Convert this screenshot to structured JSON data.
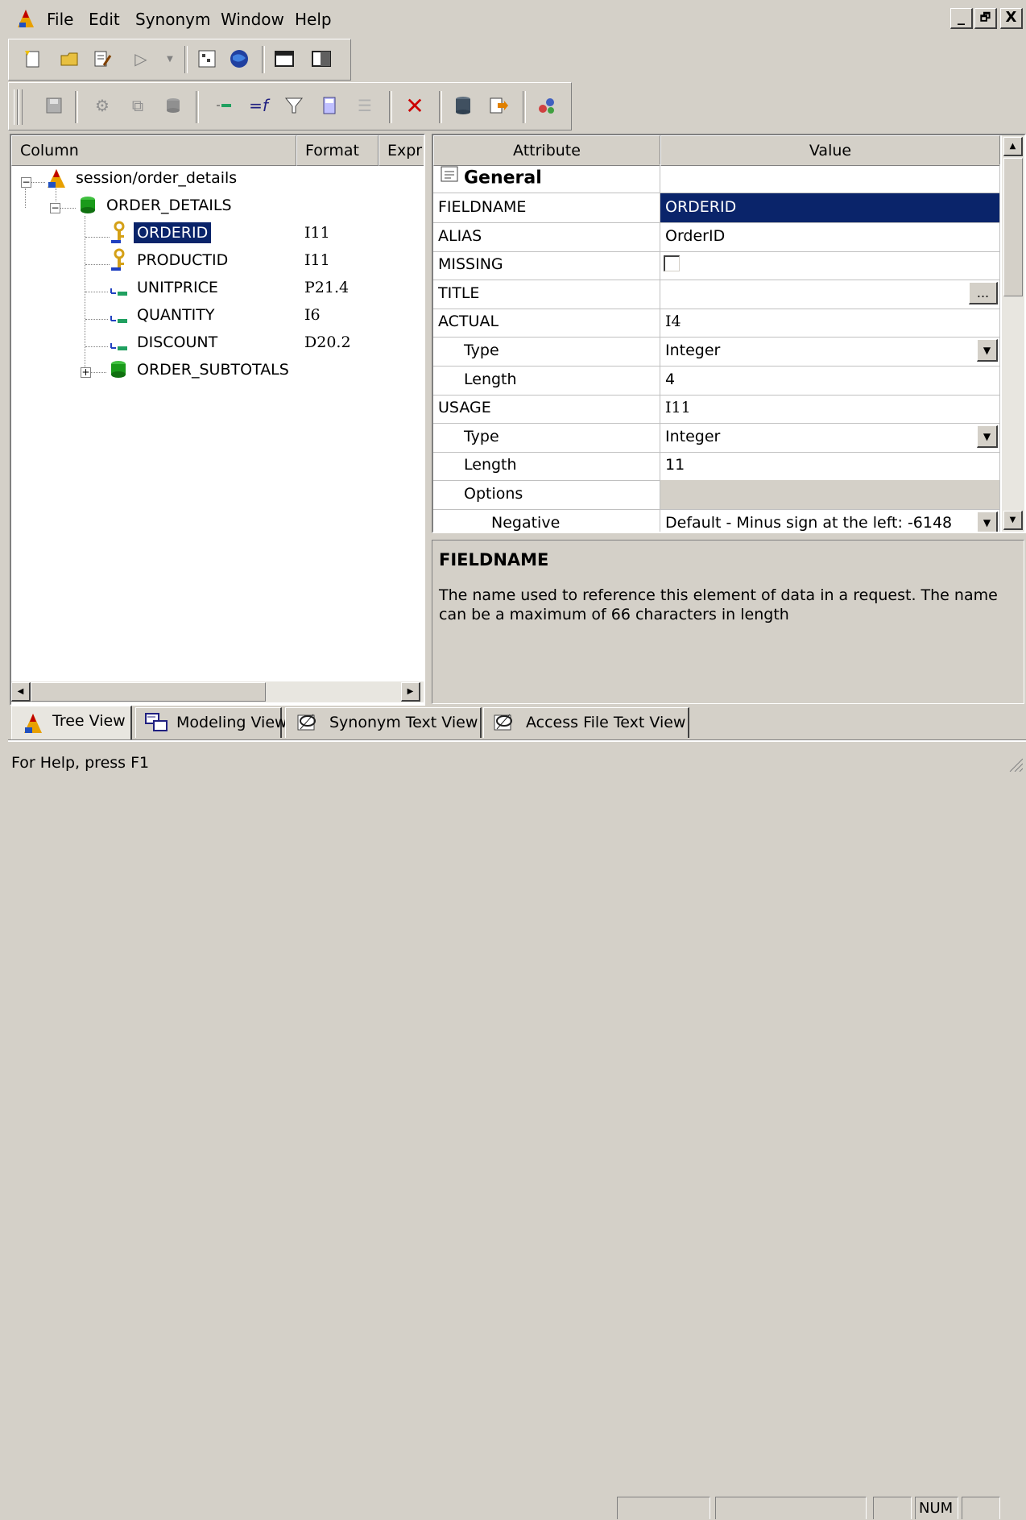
{
  "menu": {
    "items": [
      "File",
      "Edit",
      "Synonym",
      "Window",
      "Help"
    ],
    "window_controls": [
      "_",
      "🗗",
      "X"
    ]
  },
  "tree": {
    "headers": {
      "column": "Column",
      "format": "Format",
      "expression": "Expr"
    },
    "root": "session/order_details",
    "segment": "ORDER_DETAILS",
    "fields": [
      {
        "name": "ORDERID",
        "format": "I11",
        "icon": "key-icon"
      },
      {
        "name": "PRODUCTID",
        "format": "I11",
        "icon": "key-icon"
      },
      {
        "name": "UNITPRICE",
        "format": "P21.4",
        "icon": "field-icon"
      },
      {
        "name": "QUANTITY",
        "format": "I6",
        "icon": "field-icon"
      },
      {
        "name": "DISCOUNT",
        "format": "D20.2",
        "icon": "field-icon"
      }
    ],
    "subsegment": "ORDER_SUBTOTALS",
    "expander_open": "−",
    "expander_closed": "+"
  },
  "grid": {
    "headers": {
      "attribute": "Attribute",
      "value": "Value"
    },
    "section": "General",
    "rows": [
      {
        "attr": "FIELDNAME",
        "value": "ORDERID",
        "indent": 0,
        "style": "selected"
      },
      {
        "attr": "ALIAS",
        "value": "OrderID",
        "indent": 0
      },
      {
        "attr": "MISSING",
        "value": "",
        "indent": 0,
        "control": "checkbox"
      },
      {
        "attr": "TITLE",
        "value": "",
        "indent": 0,
        "control": "ellipsis"
      },
      {
        "attr": "ACTUAL",
        "value": "I4",
        "indent": 0
      },
      {
        "attr": "Type",
        "value": "Integer",
        "indent": 1,
        "control": "dropdown"
      },
      {
        "attr": "Length",
        "value": "4",
        "indent": 1
      },
      {
        "attr": "USAGE",
        "value": "I11",
        "indent": 0
      },
      {
        "attr": "Type",
        "value": "Integer",
        "indent": 1,
        "control": "dropdown"
      },
      {
        "attr": "Length",
        "value": "11",
        "indent": 1
      },
      {
        "attr": "Options",
        "value": "",
        "indent": 1,
        "style": "gray"
      },
      {
        "attr": "Negative",
        "value": "Default - Minus sign at the left: -6148",
        "indent": 2,
        "control": "dropdown"
      }
    ],
    "ellipsis_label": "...",
    "dropdown_glyph": "▼"
  },
  "description": {
    "title": "FIELDNAME",
    "text": "The name used to reference this element of data in a request. The name can be a maximum of 66 characters in length"
  },
  "tabs": [
    {
      "label": "Tree View",
      "icon": "tree-view-icon",
      "active": true
    },
    {
      "label": "Modeling View",
      "icon": "modeling-view-icon",
      "active": false
    },
    {
      "label": "Synonym Text View",
      "icon": "synonym-text-icon",
      "active": false
    },
    {
      "label": "Access File Text View",
      "icon": "access-file-icon",
      "active": false
    }
  ],
  "status": {
    "help": "For Help, press F1",
    "num": "NUM"
  },
  "colors": {
    "selection": "#0a246a",
    "chrome": "#d4d0c8",
    "delete_red": "#cc0000",
    "segment_green": "#1a9a1a",
    "key_gold": "#d4a017"
  }
}
